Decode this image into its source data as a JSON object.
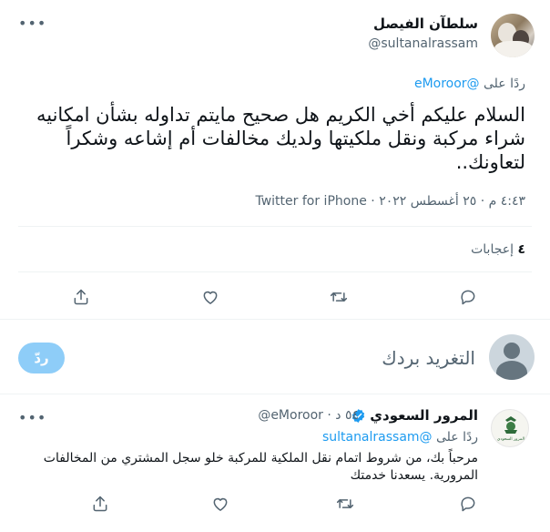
{
  "main_tweet": {
    "author_name": "سلطآن الفيصل",
    "author_handle": "@sultanalrassam",
    "reply_to_prefix": "ردًا على ",
    "reply_to_handle": "@eMoroor",
    "text": "السلام عليكم أخي الكريم هل صحيح مايتم تداوله بشأن امكانيه شراء مركبة ونقل ملكيتها ولديك مخالفات أم إشاعه وشكراً لتعاونك..",
    "meta": "٤:٤٣ م · ٢٥ أغسطس ٢٠٢٢ · Twitter for iPhone",
    "likes_count": "٤",
    "likes_label": " إعجابات",
    "more_icon": "more-dots-icon"
  },
  "compose": {
    "placeholder": "التغريد بردك",
    "reply_button": "ردّ"
  },
  "reply_tweet": {
    "author_name": "المرور السعودي",
    "author_handle": "@eMoroor",
    "time": "٥٤ د",
    "separator": " · ",
    "reply_to_prefix": "ردًا على ",
    "reply_to_handle": "@sultanalrassam",
    "text": "مرحباً بك، من شروط اتمام نقل الملكية للمركبة خلو سجل المشتري من المخالفات المرورية. يسعدنا خدمتك",
    "avatar_text": "المرور السعودي"
  },
  "colors": {
    "accent": "#1d9bf0",
    "secondary_text": "#536471",
    "reply_button_disabled": "#8ecdf8"
  }
}
